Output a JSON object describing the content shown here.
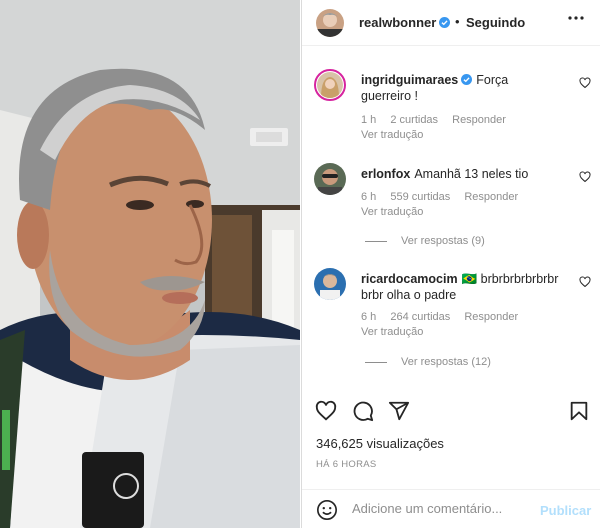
{
  "post": {
    "username": "realwbonner",
    "verified": true,
    "separator": "•",
    "follow_status": "Seguindo"
  },
  "comments": [
    {
      "username": "ingridguimaraes",
      "verified": true,
      "text": "Força guerreiro !",
      "time": "1 h",
      "likes": "2 curtidas",
      "reply": "Responder",
      "translate": "Ver tradução"
    },
    {
      "username": "erlonfox",
      "text": "Amanhã 13 neles tio",
      "time": "6 h",
      "likes": "559 curtidas",
      "reply": "Responder",
      "translate": "Ver tradução",
      "view_replies": "Ver respostas (9)"
    },
    {
      "username": "ricardocamocim",
      "text": "🇧🇷 brbrbrbrbrbrbr brbr olha o padre",
      "time": "6 h",
      "likes": "264 curtidas",
      "reply": "Responder",
      "translate": "Ver tradução",
      "view_replies": "Ver respostas (12)"
    }
  ],
  "stats": {
    "views": "346,625 visualizações",
    "posted": "HÁ 6 HORAS"
  },
  "comment_box": {
    "placeholder": "Adicione um comentário...",
    "publish": "Publicar"
  },
  "colors": {
    "verified": "#3897f0",
    "publish_disabled": "#b2dffc",
    "secondary_text": "#8e8e8e"
  },
  "icons": [
    "heart-icon",
    "comment-icon",
    "share-icon",
    "bookmark-icon",
    "emoji-icon",
    "more-icon",
    "verified-icon"
  ]
}
